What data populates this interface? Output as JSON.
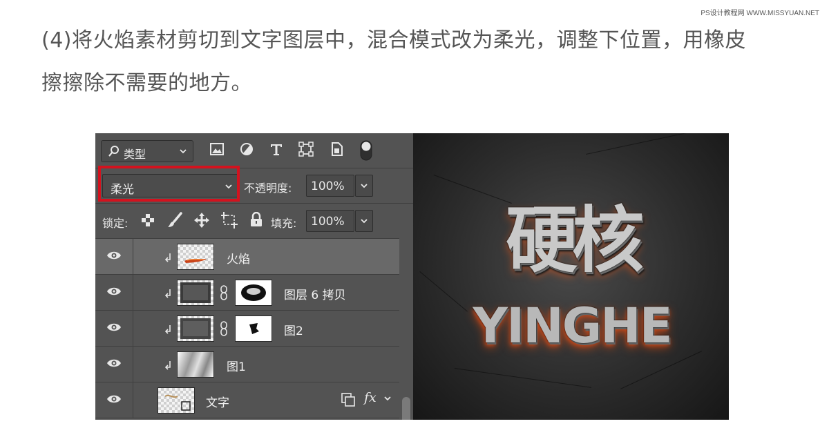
{
  "watermark": "PS设计教程网 WWW.MISSYUAN.NET",
  "instruction": {
    "line1": "(4)将火焰素材剪切到文字图层中，混合模式改为柔光，调整下位置，用橡皮",
    "line2": "擦擦除不需要的地方。"
  },
  "layers_panel": {
    "filter_label": "类型",
    "blend_mode": "柔光",
    "opacity_label": "不透明度:",
    "opacity_value": "100%",
    "lock_label": "锁定:",
    "fill_label": "填充:",
    "fill_value": "100%",
    "layers": [
      {
        "name": "火焰",
        "selected": true,
        "clipped": true,
        "has_mask": false
      },
      {
        "name": "图层 6 拷贝",
        "selected": false,
        "clipped": true,
        "has_mask": true
      },
      {
        "name": "图2",
        "selected": false,
        "clipped": true,
        "has_mask": true
      },
      {
        "name": "图1",
        "selected": false,
        "clipped": true,
        "has_mask": false
      },
      {
        "name": "文字",
        "selected": false,
        "clipped": false,
        "has_mask": false,
        "fx": "fx"
      }
    ]
  },
  "artwork": {
    "main_text": "硬核",
    "sub_text": "YINGHE"
  },
  "colors": {
    "panel_bg": "#535353",
    "highlight": "#d4121e",
    "selected_row": "#696969",
    "instruction_text": "#555555"
  }
}
